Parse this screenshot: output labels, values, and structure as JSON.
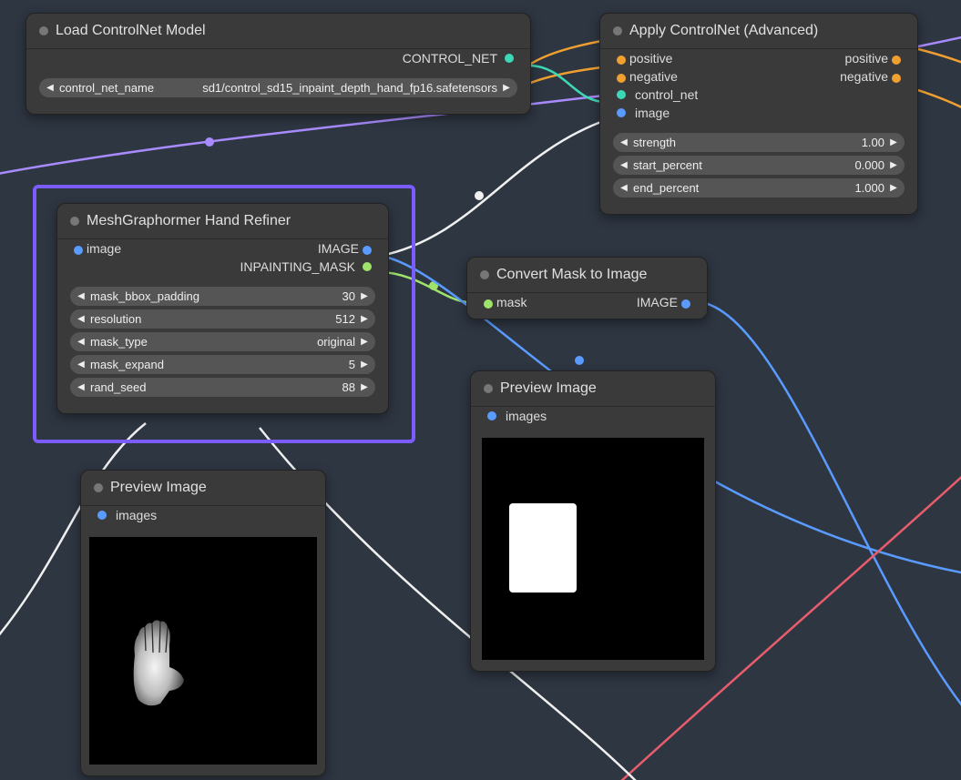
{
  "nodes": {
    "load_controlnet": {
      "title": "Load ControlNet Model",
      "output": "CONTROL_NET",
      "param_label": "control_net_name",
      "param_value": "sd1/control_sd15_inpaint_depth_hand_fp16.safetensors"
    },
    "apply_controlnet": {
      "title": "Apply ControlNet (Advanced)",
      "inputs": {
        "positive": "positive",
        "negative": "negative",
        "control_net": "control_net",
        "image": "image"
      },
      "outputs": {
        "positive": "positive",
        "negative": "negative"
      },
      "params": [
        {
          "label": "strength",
          "value": "1.00"
        },
        {
          "label": "start_percent",
          "value": "0.000"
        },
        {
          "label": "end_percent",
          "value": "1.000"
        }
      ]
    },
    "meshgraphormer": {
      "title": "MeshGraphormer Hand Refiner",
      "input": "image",
      "outputs": {
        "image": "IMAGE",
        "mask": "INPAINTING_MASK"
      },
      "params": [
        {
          "label": "mask_bbox_padding",
          "value": "30"
        },
        {
          "label": "resolution",
          "value": "512"
        },
        {
          "label": "mask_type",
          "value": "original"
        },
        {
          "label": "mask_expand",
          "value": "5"
        },
        {
          "label": "rand_seed",
          "value": "88"
        }
      ]
    },
    "convert_mask": {
      "title": "Convert Mask to Image",
      "input": "mask",
      "output": "IMAGE"
    },
    "preview1": {
      "title": "Preview Image",
      "input": "images"
    },
    "preview2": {
      "title": "Preview Image",
      "input": "images"
    }
  }
}
